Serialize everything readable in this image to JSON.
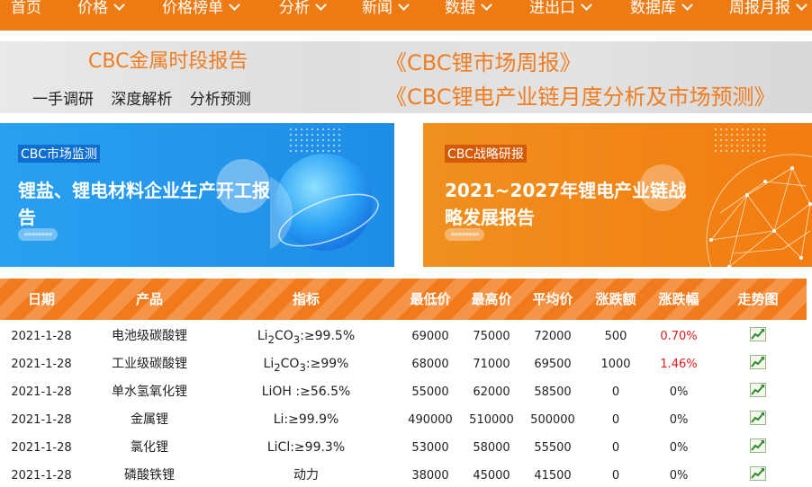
{
  "nav": {
    "items": [
      {
        "label": "首页",
        "has_menu": false
      },
      {
        "label": "价格",
        "has_menu": true
      },
      {
        "label": "价格榜单",
        "has_menu": true
      },
      {
        "label": "分析",
        "has_menu": true
      },
      {
        "label": "新闻",
        "has_menu": true
      },
      {
        "label": "数据",
        "has_menu": true
      },
      {
        "label": "进出口",
        "has_menu": true
      },
      {
        "label": "数据库",
        "has_menu": true
      },
      {
        "label": "周报月报",
        "has_menu": true
      }
    ],
    "bg_color": "#ee7a12"
  },
  "banner": {
    "title_left": "CBC金属时段报告",
    "subtitle_left": "一手调研 深度解析 分析预测",
    "title_right_1": "《CBC锂市场周报》",
    "title_right_2": "《CBC锂电产业链月度分析及市场预测》",
    "accent_color": "#f07d20"
  },
  "cards": [
    {
      "tag": "CBC市场监测",
      "title": "锂盐、锂电材料企业生产开工报告",
      "pill": "««««««««",
      "color": "#1e8de6"
    },
    {
      "tag": "CBC战略研报",
      "title": "2021~2027年锂电产业链战略发展报告",
      "pill": "««««««««",
      "color": "#f27c10"
    }
  ],
  "table": {
    "headers": [
      "日期",
      "产品",
      "指标",
      "最低价",
      "最高价",
      "平均价",
      "涨跌额",
      "涨跌幅",
      "走势图"
    ],
    "rows": [
      {
        "date": "2021-1-28",
        "product": "电池级碳酸锂",
        "spec_html": "Li<sub>2</sub>CO<sub>3</sub>:≥99.5%",
        "min": "69000",
        "max": "75000",
        "avg": "72000",
        "change": "500",
        "pct": "0.70%",
        "up": true
      },
      {
        "date": "2021-1-28",
        "product": "工业级碳酸锂",
        "spec_html": "Li<sub>2</sub>CO<sub>3</sub>:≥99%",
        "min": "68000",
        "max": "71000",
        "avg": "69500",
        "change": "1000",
        "pct": "1.46%",
        "up": true
      },
      {
        "date": "2021-1-28",
        "product": "单水氢氧化锂",
        "spec_html": "LiOH :≥56.5%",
        "min": "55000",
        "max": "62000",
        "avg": "58500",
        "change": "0",
        "pct": "0%",
        "up": false
      },
      {
        "date": "2021-1-28",
        "product": "金属锂",
        "spec_html": "Li:≥99.9%",
        "min": "490000",
        "max": "510000",
        "avg": "500000",
        "change": "0",
        "pct": "0%",
        "up": false
      },
      {
        "date": "2021-1-28",
        "product": "氯化锂",
        "spec_html": "LiCl:≥99.3%",
        "min": "53000",
        "max": "58000",
        "avg": "55500",
        "change": "0",
        "pct": "0%",
        "up": false
      },
      {
        "date": "2021-1-28",
        "product": "磷酸铁锂",
        "spec_html": "动力",
        "min": "38000",
        "max": "45000",
        "avg": "41500",
        "change": "0",
        "pct": "0%",
        "up": false
      }
    ],
    "up_color": "#e01b1b",
    "header_color": "#f07a1c"
  }
}
